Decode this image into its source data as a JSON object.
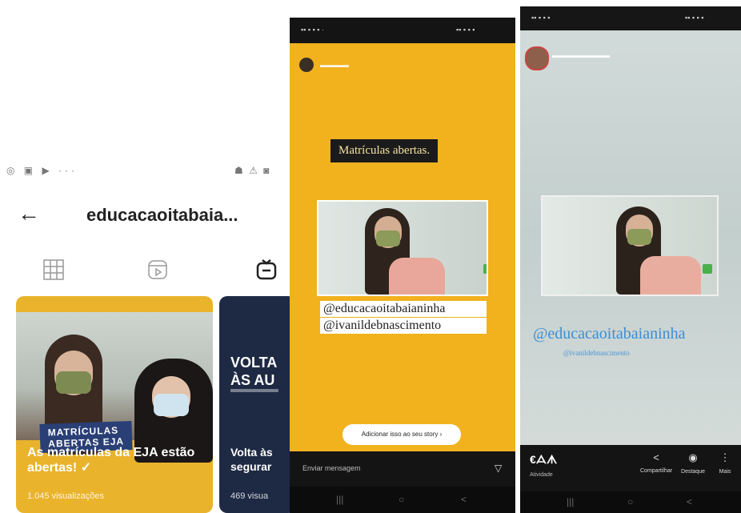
{
  "left": {
    "status_left": "◎ ▣ ▶ ···",
    "status_right": "☗ ⚠ ◙",
    "profile_name": "educacaoitabaia...",
    "tabs": [
      "grid",
      "reels",
      "igtv"
    ],
    "card1": {
      "tag": "MATRÍCULAS\nABERTAS EJA",
      "title": "As matrículas da EJA estão abertas! ✓",
      "views": "1.045 visualizações"
    },
    "card2": {
      "big": "VOLTA\nÀS AU",
      "title": "Volta às\nsegurar",
      "views": "469 visua"
    }
  },
  "middle": {
    "label": "Matrículas abertas.",
    "mentions": [
      "@educacaoitabaianinha",
      "@ivanildebnascimento"
    ],
    "add_story": "Adicionar isso ao seu story ›",
    "reply_placeholder": "Enviar mensagem",
    "send_icon": "▽"
  },
  "right": {
    "mention_main": "@educacaoitabaianinha",
    "mention_sub": "@ivanildebnascimento",
    "activity": "€ᗋᗑ",
    "activity_sub": "Atividade",
    "actions": [
      {
        "icon": "<",
        "label": "Compartilhar"
      },
      {
        "icon": "◉",
        "label": "Destaque"
      },
      {
        "icon": "⋮",
        "label": "Mais"
      }
    ]
  },
  "nav": {
    "items": [
      "|||",
      "○",
      "<"
    ]
  }
}
